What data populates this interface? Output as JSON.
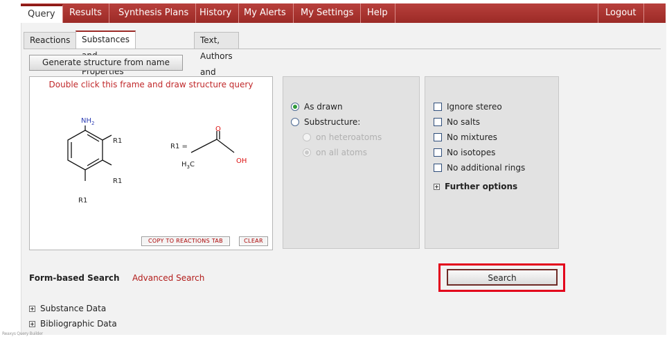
{
  "nav": {
    "items": [
      "Query",
      "Results",
      "Synthesis Plans",
      "History",
      "My Alerts",
      "My Settings",
      "Help"
    ],
    "active": "Query",
    "logout": "Logout"
  },
  "tabs": [
    "Reactions",
    "Substances and Properties",
    "Text, Authors and more"
  ],
  "active_tab": "Substances and Properties",
  "generate_button": "Generate structure from name",
  "draw": {
    "hint": "Double click this frame and draw structure query",
    "copy_button": "COPY TO REACTIONS TAB",
    "clear_button": "CLEAR",
    "molecule": {
      "nh2": "NH",
      "nh2_sub": "2",
      "r1": "R1",
      "r1_def": "R1 =",
      "h3c": "H",
      "h3c_sub": "3",
      "h3c_c": "C",
      "o": "O",
      "oh": "OH"
    }
  },
  "match": {
    "as_drawn": "As drawn",
    "substructure": "Substructure:",
    "on_heteroatoms": "on heteroatoms",
    "on_all_atoms": "on all atoms"
  },
  "filters": {
    "ignore_stereo": "Ignore stereo",
    "no_salts": "No salts",
    "no_mixtures": "No mixtures",
    "no_isotopes": "No isotopes",
    "no_additional_rings": "No additional rings",
    "further_options": "Further options"
  },
  "search_button": "Search",
  "form_based": "Form-based Search",
  "advanced_search": "Advanced Search",
  "tree": [
    "Substance Data",
    "Bibliographic Data"
  ],
  "footer": "Reaxys Query Builder",
  "colors": {
    "nav": "#9c2a26",
    "accent_red": "#c0282a",
    "highlight": "#e3001b"
  }
}
